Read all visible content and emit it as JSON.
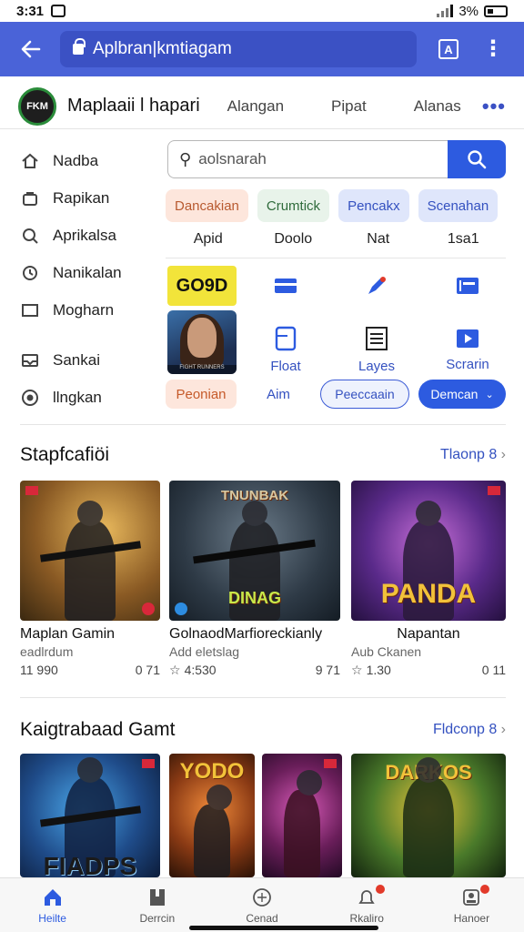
{
  "status_bar": {
    "time": "3:31",
    "battery": "3%"
  },
  "browser": {
    "url": "Aplbran|kmtiagam"
  },
  "app_header": {
    "logo_text": "FKM",
    "title": "Maplaaii l hapari",
    "nav": [
      "Alangan",
      "Pipat",
      "Alanas"
    ],
    "more": "•••"
  },
  "sidebar": {
    "items": [
      {
        "label": "Nadba",
        "icon": "home-icon"
      },
      {
        "label": "Rapikan",
        "icon": "bag-icon"
      },
      {
        "label": "Aprikalsa",
        "icon": "search-icon"
      },
      {
        "label": "Nanikalan",
        "icon": "clock-icon"
      },
      {
        "label": "Mogharn",
        "icon": "window-icon"
      },
      {
        "label": "Sankai",
        "icon": "inbox-icon"
      },
      {
        "label": "llngkan",
        "icon": "record-icon"
      }
    ]
  },
  "search": {
    "placeholder": "aolsnarah"
  },
  "chips": [
    "Dancakian",
    "Crumtick",
    "Pencakx",
    "Scenahan"
  ],
  "columns": [
    "Apid",
    "Doolo",
    "Nat",
    "1sa1"
  ],
  "grid": {
    "thumb_text": "GO9D",
    "thumb_caption": "FIGHT RUNNERS",
    "labels": [
      "Float",
      "Layes",
      "Scrarin"
    ]
  },
  "buttons": {
    "peach": "Peonian",
    "aim": "Aim",
    "outline": "Peeccaain",
    "primary": "Demcan"
  },
  "section1": {
    "title": "Stapfcafiöi",
    "link": "Tlaonp 8",
    "cards": [
      {
        "title": "Maplan Gamin",
        "sub": "eadlrdum",
        "left": "11 990",
        "right": "0 71"
      },
      {
        "title": "GolnaodMarfioreckianly",
        "sub": "Add eletslag",
        "left": "4:530",
        "right": "9 71",
        "logo": "TNUNBAK",
        "logo2": "DINAG"
      },
      {
        "title": "Napantan",
        "sub": "Aub Ckanen",
        "left": "1.30",
        "right": "0 11",
        "logo": "PANDA"
      }
    ]
  },
  "section2": {
    "title": "Kaigtrabaad Gamt",
    "link": "Fldconp 8",
    "logos": [
      "FIADPS",
      "YODO",
      "",
      "DARKOS"
    ]
  },
  "bottom_nav": [
    {
      "label": "Heilte",
      "icon": "home-icon",
      "active": true
    },
    {
      "label": "Derrcin",
      "icon": "book-icon",
      "active": false
    },
    {
      "label": "Cenad",
      "icon": "compass-icon",
      "active": false
    },
    {
      "label": "Rkaliro",
      "icon": "bell-icon",
      "active": false
    },
    {
      "label": "Hanoer",
      "icon": "profile-icon",
      "active": false
    }
  ],
  "colors": {
    "brand": "#4a63d8",
    "accent": "#2d5be0"
  }
}
